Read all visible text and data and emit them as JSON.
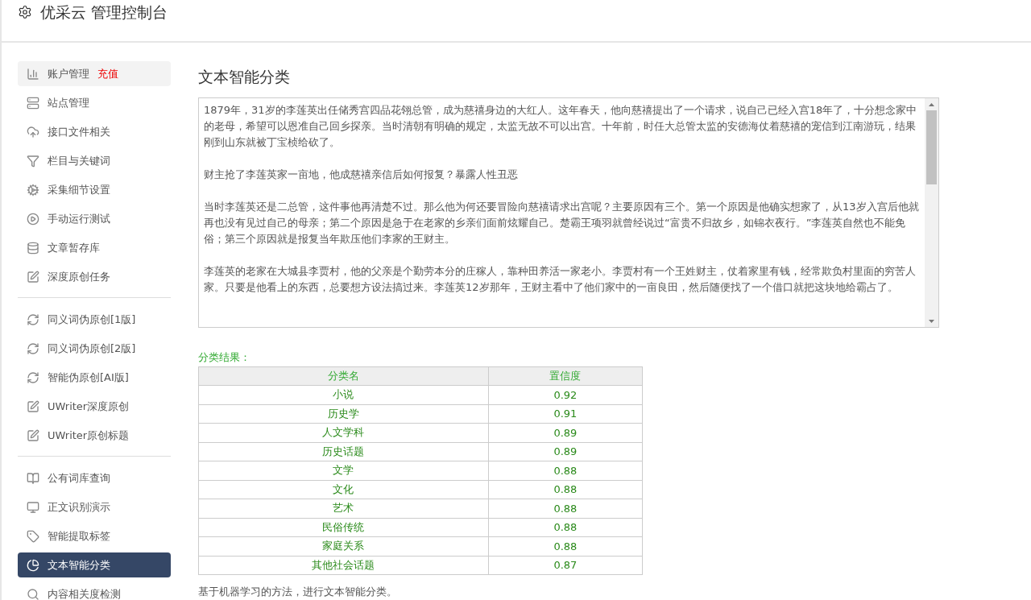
{
  "header": {
    "title": "优采云 管理控制台"
  },
  "sidebar": {
    "groups": [
      [
        {
          "label": "账户管理",
          "badge": "充值",
          "selected": false,
          "highlighted": true
        },
        {
          "label": "站点管理",
          "selected": false
        },
        {
          "label": "接口文件相关",
          "selected": false
        },
        {
          "label": "栏目与关键词",
          "selected": false
        },
        {
          "label": "采集细节设置",
          "selected": false
        },
        {
          "label": "手动运行测试",
          "selected": false
        },
        {
          "label": "文章暂存库",
          "selected": false
        },
        {
          "label": "深度原创任务",
          "selected": false
        }
      ],
      [
        {
          "label": "同义词伪原创[1版]",
          "selected": false
        },
        {
          "label": "同义词伪原创[2版]",
          "selected": false
        },
        {
          "label": "智能伪原创[AI版]",
          "selected": false
        },
        {
          "label": "UWriter深度原创",
          "selected": false
        },
        {
          "label": "UWriter原创标题",
          "selected": false
        }
      ],
      [
        {
          "label": "公有词库查询",
          "selected": false
        },
        {
          "label": "正文识别演示",
          "selected": false
        },
        {
          "label": "智能提取标签",
          "selected": false
        },
        {
          "label": "文本智能分类",
          "selected": true
        },
        {
          "label": "内容相关度检测",
          "selected": false
        }
      ]
    ]
  },
  "main": {
    "title": "文本智能分类",
    "article": [
      "1879年，31岁的李莲英出任储秀宫四品花翎总管，成为慈禧身边的大红人。这年春天，他向慈禧提出了一个请求，说自己已经入宫18年了，十分想念家中的老母，希望可以恩准自己回乡探亲。当时清朝有明确的规定，太监无故不可以出宫。十年前，时任大总管太监的安德海仗着慈禧的宠信到江南游玩，结果刚到山东就被丁宝桢给砍了。",
      "财主抢了李莲英家一亩地，他成慈禧亲信后如何报复？暴露人性丑恶",
      "当时李莲英还是二总管，这件事他再清楚不过。那么他为何还要冒险向慈禧请求出宫呢？主要原因有三个。第一个原因是他确实想家了，从13岁入宫后他就再也没有见过自己的母亲；第二个原因是急于在老家的乡亲们面前炫耀自己。楚霸王项羽就曾经说过“富贵不归故乡，如锦衣夜行。”李莲英自然也不能免俗；第三个原因就是报复当年欺压他们李家的王财主。",
      "李莲英的老家在大城县李贾村，他的父亲是个勤劳本分的庄稼人，靠种田养活一家老小。李贾村有一个王姓财主，仗着家里有钱，经常欺负村里面的穷苦人家。只要是他看上的东西，总要想方设法搞过来。李莲英12岁那年，王财主看中了他们家中的一亩良田，然后随便找了一个借口就把这块地给霸占了。"
    ],
    "result_label": "分类结果：",
    "table": {
      "columns": [
        "分类名",
        "置信度"
      ],
      "rows": [
        [
          "小说",
          "0.92"
        ],
        [
          "历史学",
          "0.91"
        ],
        [
          "人文学科",
          "0.89"
        ],
        [
          "历史话题",
          "0.89"
        ],
        [
          "文学",
          "0.88"
        ],
        [
          "文化",
          "0.88"
        ],
        [
          "艺术",
          "0.88"
        ],
        [
          "民俗传统",
          "0.88"
        ],
        [
          "家庭关系",
          "0.88"
        ],
        [
          "其他社会话题",
          "0.87"
        ]
      ]
    },
    "note": "基于机器学习的方法，进行文本智能分类。"
  }
}
